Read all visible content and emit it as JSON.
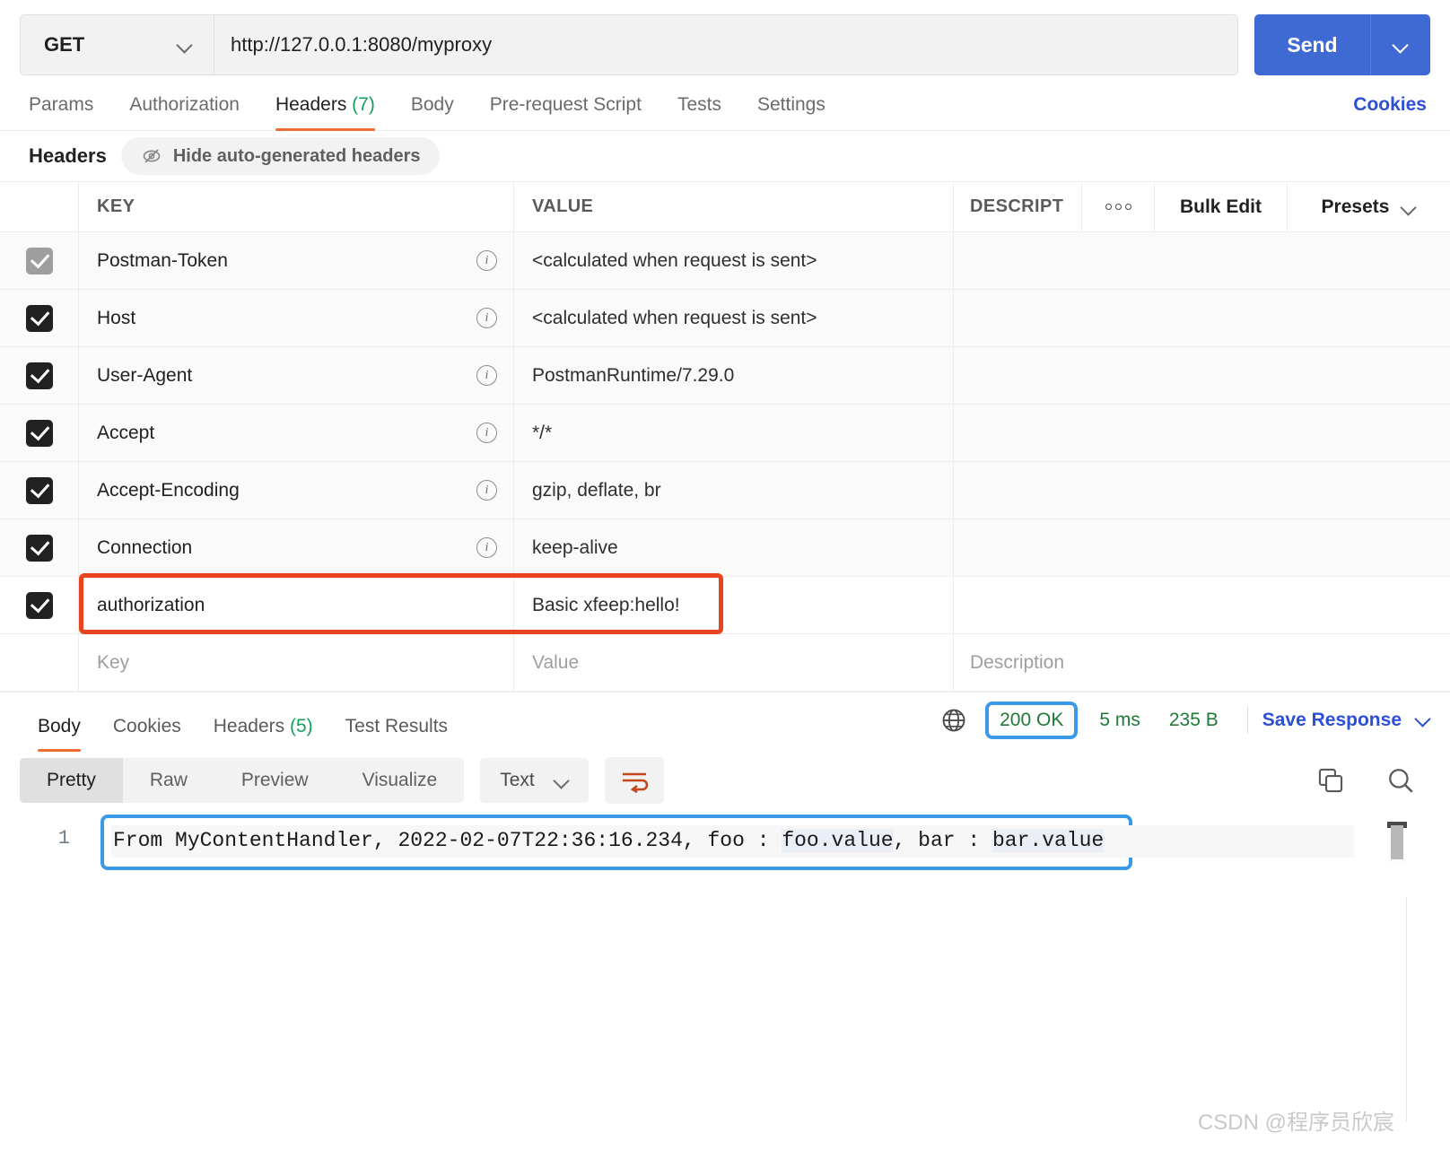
{
  "request": {
    "method": "GET",
    "url": "http://127.0.0.1:8080/myproxy",
    "send_label": "Send",
    "tabs": [
      {
        "label": "Params",
        "count": "",
        "active": false
      },
      {
        "label": "Authorization",
        "count": "",
        "active": false
      },
      {
        "label": "Headers",
        "count": "(7)",
        "active": true
      },
      {
        "label": "Body",
        "count": "",
        "active": false
      },
      {
        "label": "Pre-request Script",
        "count": "",
        "active": false
      },
      {
        "label": "Tests",
        "count": "",
        "active": false
      },
      {
        "label": "Settings",
        "count": "",
        "active": false
      }
    ],
    "cookies_link": "Cookies"
  },
  "headers_section": {
    "title": "Headers",
    "hide_auto_label": "Hide auto-generated headers",
    "columns": {
      "key": "KEY",
      "value": "VALUE",
      "description": "DESCRIPT",
      "bulk_edit": "Bulk Edit",
      "presets": "Presets"
    },
    "rows": [
      {
        "checked": true,
        "disabled": true,
        "key": "Postman-Token",
        "value": "<calculated when request is sent>",
        "description": "",
        "info": true,
        "highlighted": false
      },
      {
        "checked": true,
        "disabled": false,
        "key": "Host",
        "value": "<calculated when request is sent>",
        "description": "",
        "info": true,
        "highlighted": false
      },
      {
        "checked": true,
        "disabled": false,
        "key": "User-Agent",
        "value": "PostmanRuntime/7.29.0",
        "description": "",
        "info": true,
        "highlighted": false
      },
      {
        "checked": true,
        "disabled": false,
        "key": "Accept",
        "value": "*/*",
        "description": "",
        "info": true,
        "highlighted": false
      },
      {
        "checked": true,
        "disabled": false,
        "key": "Accept-Encoding",
        "value": "gzip, deflate, br",
        "description": "",
        "info": true,
        "highlighted": false
      },
      {
        "checked": true,
        "disabled": false,
        "key": "Connection",
        "value": "keep-alive",
        "description": "",
        "info": true,
        "highlighted": false
      },
      {
        "checked": true,
        "disabled": false,
        "key": "authorization",
        "value": "Basic xfeep:hello!",
        "description": "",
        "info": false,
        "highlighted": true
      }
    ],
    "empty_row": {
      "key_placeholder": "Key",
      "value_placeholder": "Value",
      "description_placeholder": "Description"
    },
    "highlight_color": "#e8451f"
  },
  "response": {
    "tabs": [
      {
        "label": "Body",
        "count": "",
        "active": true
      },
      {
        "label": "Cookies",
        "count": "",
        "active": false
      },
      {
        "label": "Headers",
        "count": "(5)",
        "active": false
      },
      {
        "label": "Test Results",
        "count": "",
        "active": false
      }
    ],
    "status": "200 OK",
    "time": "5 ms",
    "size": "235 B",
    "save_response_label": "Save Response",
    "status_highlight_color": "#3b9ae8",
    "view_modes": [
      {
        "label": "Pretty",
        "active": true
      },
      {
        "label": "Raw",
        "active": false
      },
      {
        "label": "Preview",
        "active": false
      },
      {
        "label": "Visualize",
        "active": false
      }
    ],
    "format_selected": "Text",
    "body": {
      "line_number": "1",
      "text_before": "From MyContentHandler, 2022-02-07T22:36:16.234, foo : ",
      "var1": "foo.value",
      "text_mid": ", bar : ",
      "var2": "bar.value"
    }
  },
  "watermark": "CSDN @程序员欣宸"
}
